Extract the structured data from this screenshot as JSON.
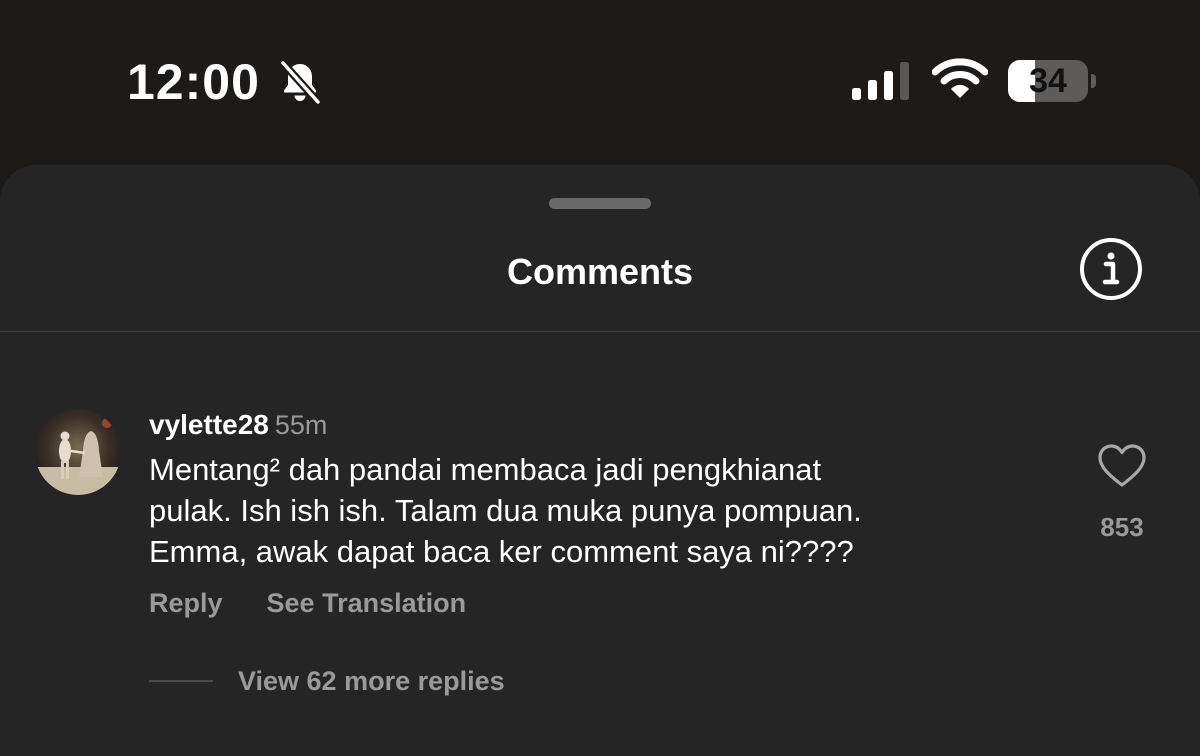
{
  "status_bar": {
    "time": "12:00",
    "battery_level": "34",
    "battery_fraction": 0.34,
    "icons": [
      "bell-slash-icon",
      "cellular-signal-icon",
      "wifi-icon",
      "battery-icon"
    ]
  },
  "sheet": {
    "title": "Comments",
    "info_icon": "info-icon"
  },
  "comment": {
    "username": "vylette28",
    "time_ago": "55m",
    "text": "Mentang² dah pandai membaca jadi pengkhianat\npulak. Ish ish ish. Talam dua muka punya pompuan.\nEmma, awak dapat baca ker comment saya ni????",
    "reply_label": "Reply",
    "see_translation_label": "See Translation",
    "like_icon": "heart-icon",
    "like_count": "853",
    "view_replies_label": "View 62 more replies"
  },
  "colors": {
    "background": "#1a1614",
    "sheet": "#252525",
    "text_primary": "#ffffff",
    "text_secondary": "#9a9a9a"
  }
}
